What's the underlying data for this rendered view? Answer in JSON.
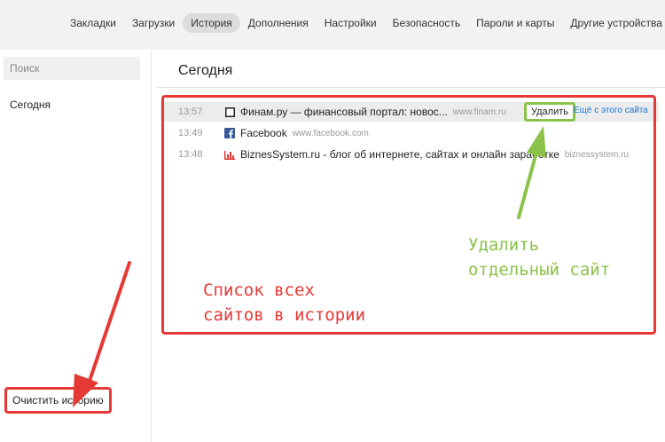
{
  "nav": {
    "tabs": [
      {
        "label": "Закладки",
        "active": false
      },
      {
        "label": "Загрузки",
        "active": false
      },
      {
        "label": "История",
        "active": true
      },
      {
        "label": "Дополнения",
        "active": false
      },
      {
        "label": "Настройки",
        "active": false
      },
      {
        "label": "Безопасность",
        "active": false
      },
      {
        "label": "Пароли и карты",
        "active": false
      },
      {
        "label": "Другие устройства",
        "active": false
      }
    ]
  },
  "sidebar": {
    "search_placeholder": "Поиск",
    "today_label": "Сегодня",
    "clear_history_label": "Очистить историю"
  },
  "main": {
    "title": "Сегодня",
    "rows": [
      {
        "time": "13:57",
        "title": "Финам.ру — финансовый портал: новос...",
        "domain": "www.finam.ru",
        "favicon": "page-icon"
      },
      {
        "time": "13:49",
        "title": "Facebook",
        "domain": "www.facebook.com",
        "favicon": "facebook-icon"
      },
      {
        "time": "13:48",
        "title": "BiznesSystem.ru - блог об интернете, сайтах и онлайн заработке",
        "domain": "biznessystem.ru",
        "favicon": "bar-chart-icon"
      }
    ],
    "delete_label": "Удалить",
    "more_from_site_label": "Ещё с этого сайта"
  },
  "annotations": {
    "red_text": "Список всех\nсайтов в истории",
    "green_text": "Удалить\nотдельный сайт"
  },
  "colors": {
    "red": "#e53935",
    "green": "#8bc34a",
    "link": "#1976d2",
    "facebook": "#3b5998"
  }
}
